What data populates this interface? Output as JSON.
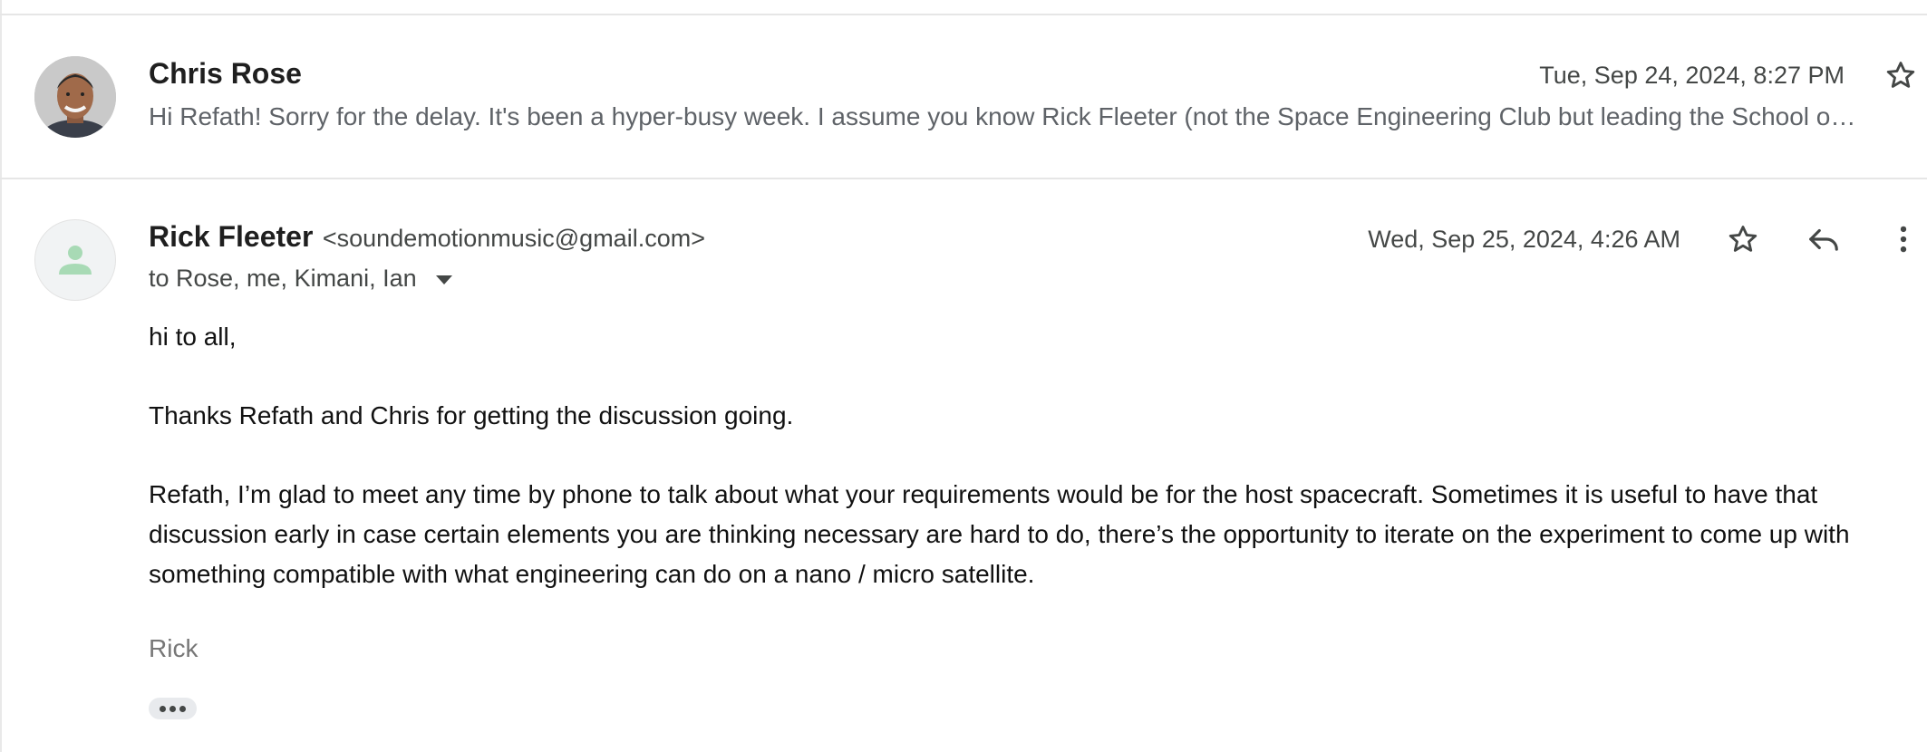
{
  "thread": {
    "collapsed_message": {
      "sender": "Chris Rose",
      "date": "Tue, Sep 24, 2024, 8:27 PM",
      "snippet": "Hi Refath! Sorry for the delay. It's been a hyper-busy week. I assume you know Rick Fleeter (not the Space Engineering Club but leading the School o…"
    },
    "expanded_message": {
      "sender_name": "Rick Fleeter",
      "sender_email": "<soundemotionmusic@gmail.com>",
      "recipients": "to Rose, me, Kimani, Ian",
      "date": "Wed, Sep 25, 2024, 4:26 AM",
      "body": {
        "greeting": "hi to all,",
        "paragraph1": "Thanks Refath and Chris for getting the discussion going.",
        "paragraph2": "Refath, I’m glad to meet any time by phone to talk about what your requirements would be for the host spacecraft.  Sometimes it is useful to have that discussion early in case certain elements you are thinking necessary are hard to do, there’s the opportunity to iterate on the experiment to come up with something compatible  with what engineering can do on a nano / micro satellite.",
        "signature": "Rick"
      }
    },
    "icons": {
      "star": "star-outline-icon",
      "reply": "reply-icon",
      "more": "more-vertical-icon",
      "recipients_dropdown": "caret-down-icon",
      "trimmed_content": "ellipsis-icon",
      "default_avatar": "person-icon"
    },
    "colors": {
      "default_avatar_person": "#a8dab5",
      "divider": "#e6e6e6"
    }
  }
}
